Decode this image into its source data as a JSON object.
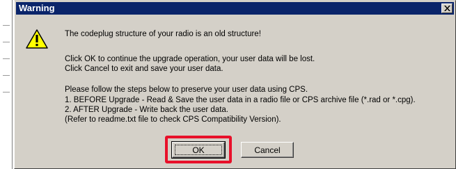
{
  "dialog": {
    "title": "Warning",
    "icon": "warning-triangle-icon",
    "close_icon": "close-icon",
    "messages": [
      "The codeplug structure of your radio is an old structure!",
      "Click OK to continue the upgrade operation, your user data will be lost.",
      "Click Cancel to exit and save your user data.",
      "Please follow the steps below to preserve your user data using CPS.",
      "1. BEFORE Upgrade - Read & Save the user data in a radio file or CPS archive file (*.rad or *.cpg).",
      "2. AFTER Upgrade - Write back the user data.",
      "(Refer to readme.txt file to check CPS Compatibility Version)."
    ],
    "buttons": {
      "ok_label": "OK",
      "cancel_label": "Cancel"
    }
  },
  "colors": {
    "titlebar": "#0a246a",
    "dialog_bg": "#d4d0c8",
    "highlight": "#e8102a",
    "warning_yellow": "#ffff00"
  }
}
